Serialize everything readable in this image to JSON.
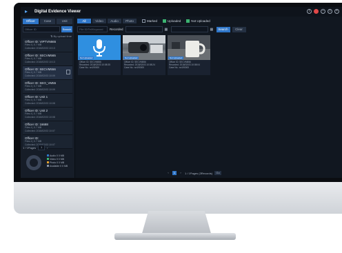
{
  "app": {
    "title": "Digital Evidence Viewer"
  },
  "sidebar": {
    "tabs": [
      {
        "label": "Officer"
      },
      {
        "label": "Case"
      },
      {
        "label": "Unit"
      }
    ],
    "search_placeholder": "Officer ID",
    "search_button": "Search",
    "sort_text": "⇅ By upload time",
    "officers": [
      {
        "name": "Officer ID: VIPTVN665",
        "line1": "Files 4 | 0.7 MB",
        "line2": "Collected: 2018/02/03 10:13"
      },
      {
        "name": "Officer ID: SECVM565",
        "line1": "Files 4 | 0.7 MB",
        "line2": "Collected: 2018/02/03 10:13"
      },
      {
        "name": "Officer ID: SECVM556",
        "line1": "Files 4 | 0.7 MB",
        "line2": "Collected: 2018/02/03 10:09"
      },
      {
        "name": "Officer ID: SEO_VM55",
        "line1": "Files 4 | 0.7 MB",
        "line2": "Collected: 2018/02/03 10:09"
      },
      {
        "name": "Officer ID: Unit 1",
        "line1": "Files 4 | 0.7 MB",
        "line2": "Collected: 2018/02/03 10:08"
      },
      {
        "name": "Officer ID: Unit 2",
        "line1": "Files 4 | 0.7 MB",
        "line2": "Collected: 2018/02/03 10:08"
      },
      {
        "name": "Officer ID: 16688",
        "line1": "Files 4 | 0.7 MB",
        "line2": "Collected: 2018/02/03 10:07"
      },
      {
        "name": "Officer ID:",
        "line1": "Files 4 | 0.7 MB",
        "line2": "Collected: 2018/02/03 10:07"
      }
    ],
    "pager": {
      "text": "1 / 1Pages",
      "page": "1"
    },
    "legend": [
      {
        "label": "Audio 0 0 MB",
        "color": "#2f76c9"
      },
      {
        "label": "Video 0 0 MB",
        "color": "#3cb371"
      },
      {
        "label": "Photo 0 0 MB",
        "color": "#e0a030"
      },
      {
        "label": "Available 0 0 MB",
        "color": "#8a95a6"
      }
    ]
  },
  "main": {
    "filters": [
      {
        "label": "All"
      },
      {
        "label": "Video"
      },
      {
        "label": "Audio"
      },
      {
        "label": "Photo"
      }
    ],
    "checks": [
      {
        "label": "Marked",
        "on": false
      },
      {
        "label": "Uploaded",
        "on": true
      },
      {
        "label": "Not Uploaded",
        "on": true
      }
    ],
    "file_placeholder": "File ID/Tel/Keyword",
    "recorded_label": "Recorded",
    "search_button": "Search",
    "clear_button": "Clear",
    "cards": [
      {
        "badge": "Not Uploaded",
        "l1": "Officer ID: SECVM556",
        "l2": "Recorded: 2018/02/03 10:08:35",
        "l3": "Case No.: sn190000"
      },
      {
        "badge": "Not Uploaded",
        "l1": "Officer ID: SECVM556",
        "l2": "Recorded: 2018/02/03 10:08:24",
        "l3": "Case No.: sn190000"
      },
      {
        "badge": "Not Uploaded",
        "l1": "Officer ID: SECVM556",
        "l2": "Recorded: 2018/02/03 10:08:04",
        "l3": "Case No.: sn190000"
      }
    ],
    "pager": {
      "prev": "‹",
      "page": "1",
      "next": "›",
      "text": "1 / 1Pages (3Records)",
      "go": "Go"
    }
  }
}
